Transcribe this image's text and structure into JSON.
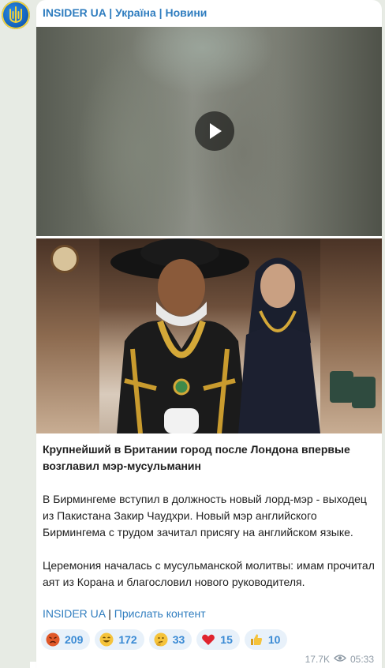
{
  "channel": {
    "name": "INSIDER UA | Україна | Новини",
    "avatar_icon": "ukraine-trident-icon"
  },
  "post": {
    "title": "Крупнейший в Британии город после Лондона впервые возглавил мэр-мусульманин",
    "paragraph1": "В Бирмингеме вступил в должность новый лорд-мэр - выходец из Пакистана Закир Чаудхри. Новый мэр английского Бирмингема с трудом зачитал присягу на английском языке.",
    "paragraph2": "Церемония началась с мусульманской молитвы: имам прочитал аят из Корана и благословил нового руководителя.",
    "link1": "INSIDER UA",
    "separator": " | ",
    "link2": "Прислать контент"
  },
  "reactions": [
    {
      "icon": "angry-face-icon",
      "count": "209",
      "color": "#e0582a"
    },
    {
      "icon": "grinning-face-icon",
      "count": "172",
      "color": "#f5c33b"
    },
    {
      "icon": "thinking-face-icon",
      "count": "33",
      "color": "#f5c33b"
    },
    {
      "icon": "red-heart-icon",
      "count": "15",
      "color": "#e0242f"
    },
    {
      "icon": "thumbs-up-icon",
      "count": "10",
      "color": "#f5c33b"
    }
  ],
  "meta": {
    "views": "17.7K",
    "time": "05:33"
  },
  "colors": {
    "link": "#2f7dbf",
    "reaction_bg": "#e8f1fa",
    "reaction_text": "#3a8ad4",
    "chat_bg": "#e7ebe4"
  }
}
